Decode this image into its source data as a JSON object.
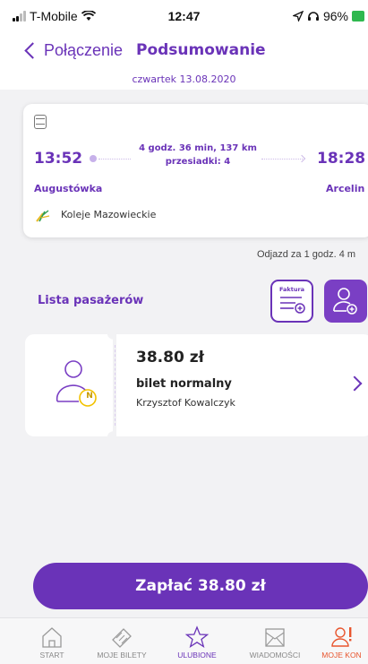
{
  "status_bar": {
    "carrier": "T-Mobile",
    "time": "12:47",
    "battery": "96%"
  },
  "header": {
    "back_label": "Połączenie",
    "title": "Podsumowanie",
    "date": "czwartek 13.08.2020"
  },
  "journey": {
    "departure_time": "13:52",
    "arrival_time": "18:28",
    "duration": "4 godz. 36 min, 137 km",
    "transfers": "przesiadki: 4",
    "departure_station": "Augustówka",
    "arrival_station": "Arcelin",
    "carrier": "Koleje Mazowieckie",
    "vehicle_icon": "bus-icon"
  },
  "departure_info": "Odjazd za 1 godz. 4 m",
  "passengers": {
    "label": "Lista pasażerów",
    "invoice_label": "Faktura"
  },
  "ticket": {
    "price": "38.80 zł",
    "type": "bilet normalny",
    "passenger": "Krzysztof Kowalczyk",
    "badge": "N"
  },
  "pay_button": "Zapłać 38.80 zł",
  "tabs": [
    {
      "label": "START",
      "icon": "home-icon"
    },
    {
      "label": "MOJE BILETY",
      "icon": "tickets-icon"
    },
    {
      "label": "ULUBIONE",
      "icon": "star-icon"
    },
    {
      "label": "WIADOMOŚCI",
      "icon": "envelope-icon"
    },
    {
      "label": "MOJE KON",
      "icon": "account-alert-icon"
    }
  ],
  "colors": {
    "accent": "#6a33b8",
    "background": "#f2f2f4",
    "alert": "#e8552e"
  }
}
